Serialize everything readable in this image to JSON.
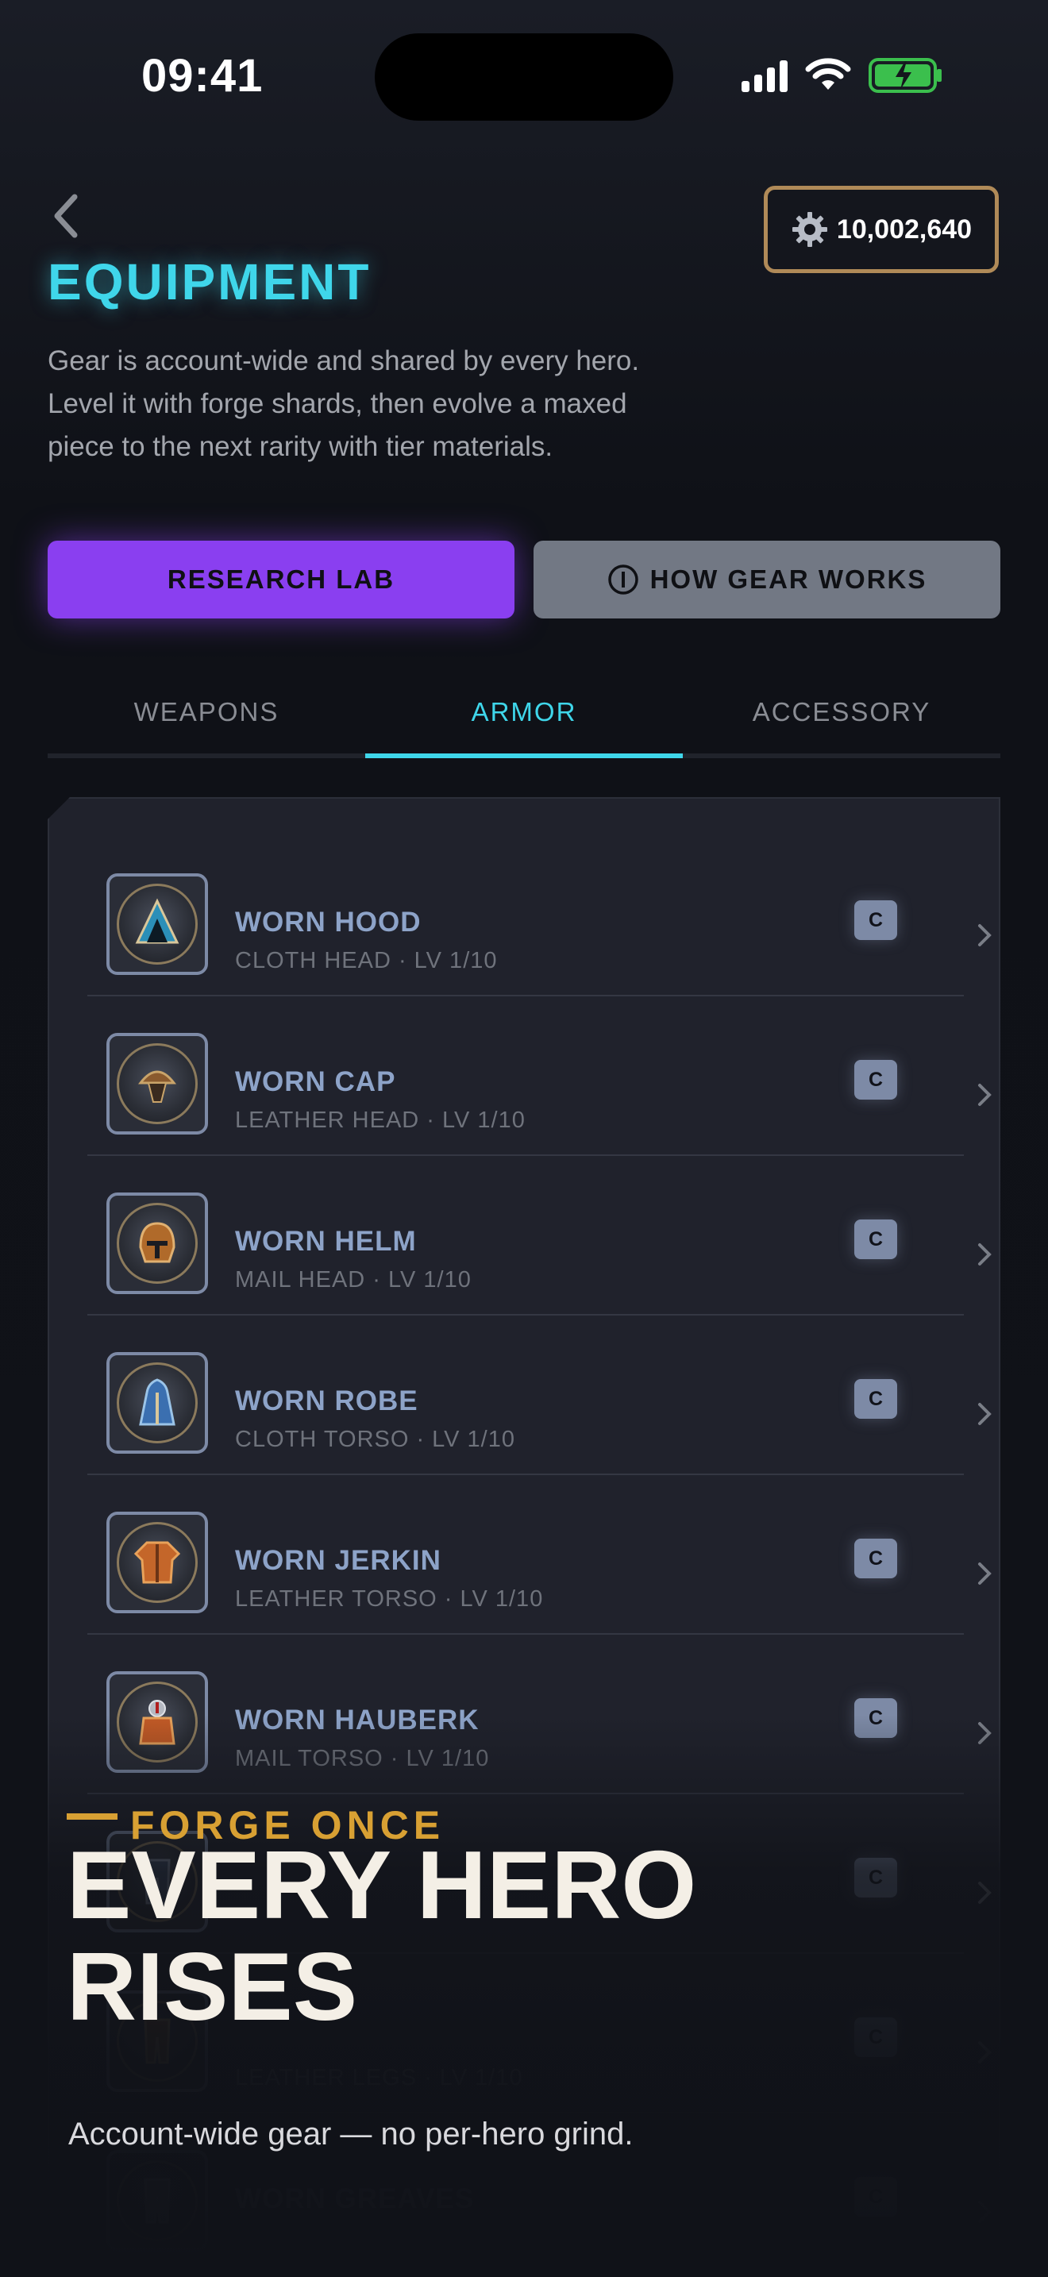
{
  "status_bar": {
    "time": "09:41"
  },
  "header": {
    "currency_value": "10,002,640",
    "title": "EQUIPMENT",
    "subtitle": "Gear is account-wide and shared by every hero. Level it with forge shards, then evolve a maxed piece to the next rarity with tier materials."
  },
  "actions": {
    "research_label": "RESEARCH LAB",
    "how_label": "HOW GEAR WORKS"
  },
  "tabs": [
    {
      "label": "WEAPONS"
    },
    {
      "label": "ARMOR",
      "active": true
    },
    {
      "label": "ACCESSORY"
    }
  ],
  "items": [
    {
      "name": "WORN HOOD",
      "meta": "CLOTH HEAD · LV 1/10",
      "rarity": "C",
      "icon": "hood-icon"
    },
    {
      "name": "WORN CAP",
      "meta": "LEATHER HEAD · LV 1/10",
      "rarity": "C",
      "icon": "cap-icon"
    },
    {
      "name": "WORN HELM",
      "meta": "MAIL HEAD · LV 1/10",
      "rarity": "C",
      "icon": "helm-icon"
    },
    {
      "name": "WORN ROBE",
      "meta": "CLOTH TORSO · LV 1/10",
      "rarity": "C",
      "icon": "robe-icon"
    },
    {
      "name": "WORN JERKIN",
      "meta": "LEATHER TORSO · LV 1/10",
      "rarity": "C",
      "icon": "jerkin-icon"
    },
    {
      "name": "WORN HAUBERK",
      "meta": "MAIL TORSO · LV 1/10",
      "rarity": "C",
      "icon": "hauberk-icon"
    },
    {
      "name": "",
      "meta": "",
      "rarity": "C",
      "icon": "leggings-icon"
    },
    {
      "name": "",
      "meta": "LEATHER LEGS · LV 1/10",
      "rarity": "C",
      "icon": "chaps-icon"
    },
    {
      "name": "WORN GREAVES",
      "meta": "",
      "rarity": "C",
      "icon": "greaves-icon"
    }
  ],
  "promo": {
    "kicker": "FORGE ONCE",
    "headline": "EVERY HERO RISES",
    "sub": "Account-wide gear — no per-hero grind."
  },
  "colors": {
    "accent_cyan": "#3fd6ea",
    "research_purple": "#8a3ff0",
    "currency_border": "#b08a58",
    "rarity_common": "#7d8aa6",
    "promo_gold": "#d8a033"
  }
}
